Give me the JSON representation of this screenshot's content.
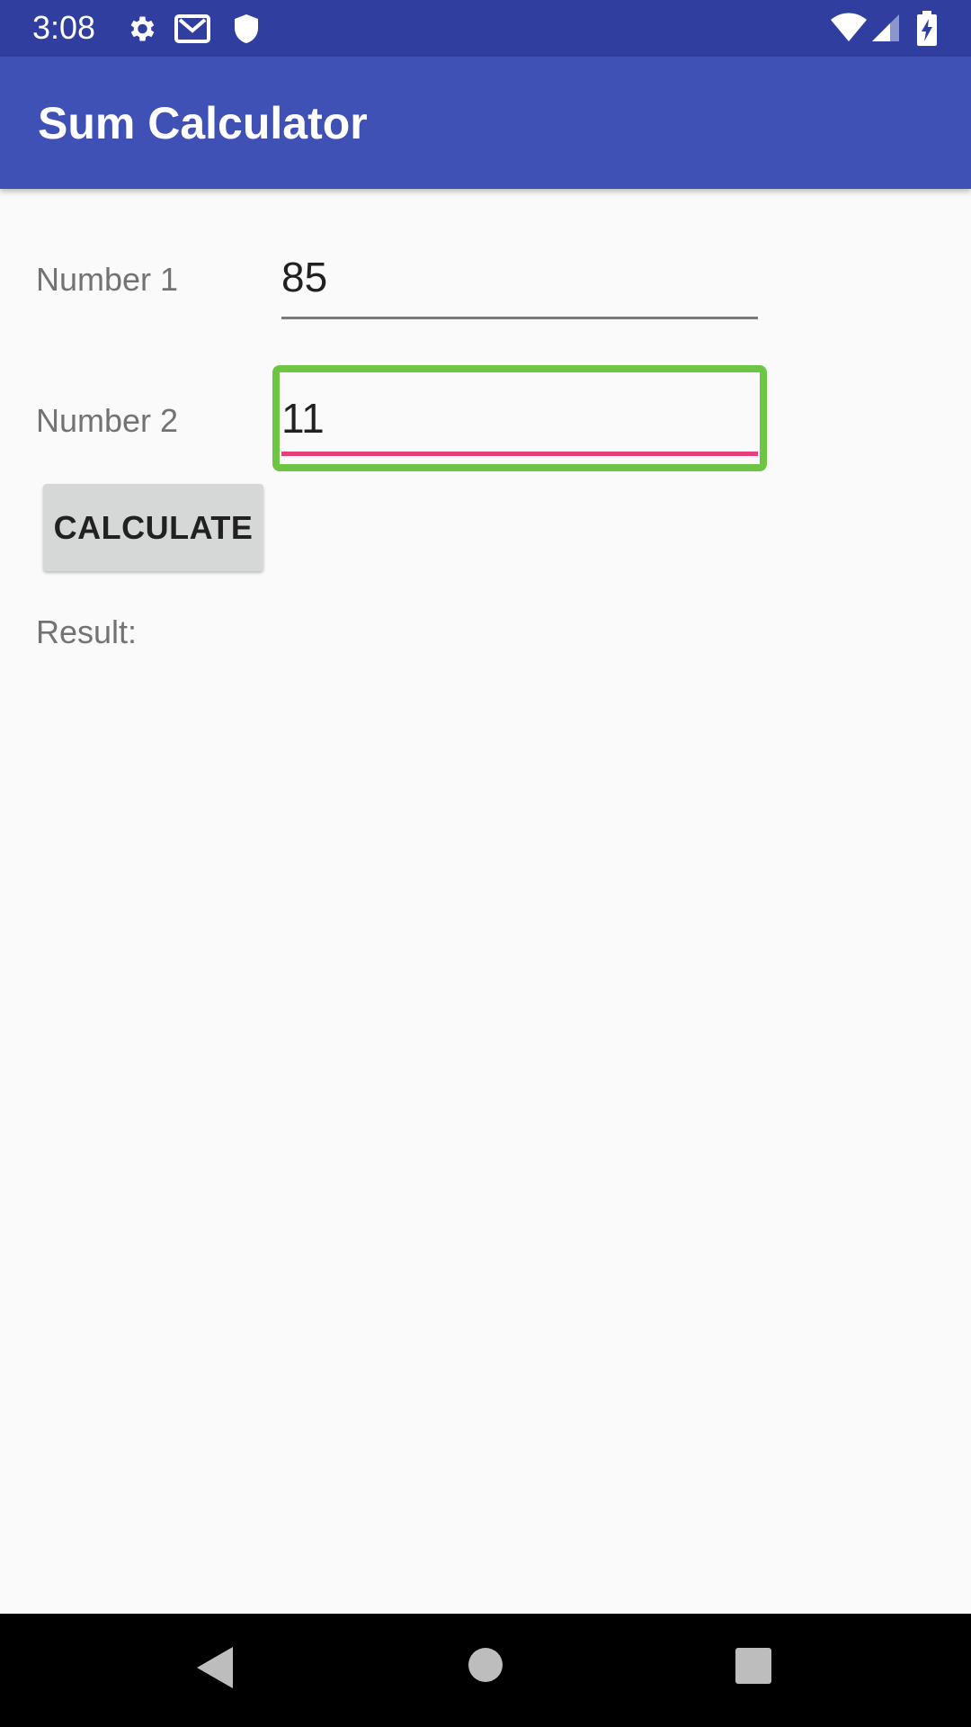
{
  "status_bar": {
    "time": "3:08",
    "icons": [
      "settings-icon",
      "gmail-icon",
      "shield-icon",
      "wifi-icon",
      "cell-signal-icon",
      "battery-charging-icon"
    ]
  },
  "app_bar": {
    "title": "Sum Calculator"
  },
  "form": {
    "number1": {
      "label": "Number 1",
      "value": "85"
    },
    "number2": {
      "label": "Number 2",
      "value": "11"
    },
    "calculate_label": "CALCULATE",
    "result_label": "Result:"
  },
  "nav_bar": {
    "icons": [
      "back-icon",
      "home-icon",
      "recents-icon"
    ]
  },
  "colors": {
    "status_bar": "#303f9f",
    "app_bar": "#3f51b5",
    "focus_underline": "#e6407a",
    "highlight_box": "#6cc644"
  }
}
